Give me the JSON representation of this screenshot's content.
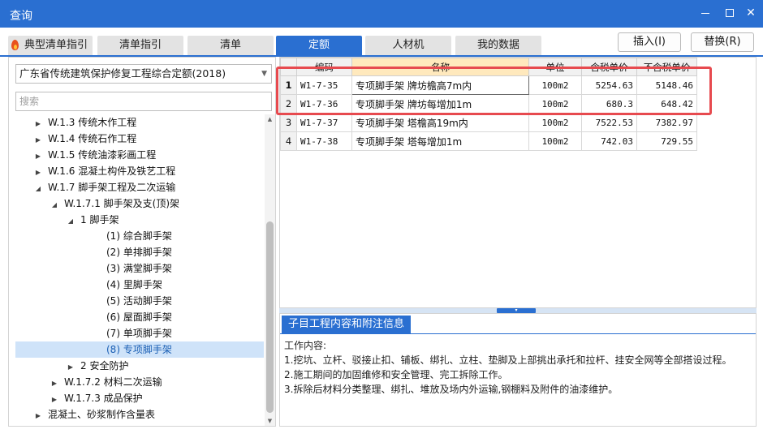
{
  "window": {
    "title": "查询"
  },
  "tabs": [
    {
      "label": "典型清单指引"
    },
    {
      "label": "清单指引"
    },
    {
      "label": "清单"
    },
    {
      "label": "定额"
    },
    {
      "label": "人材机"
    },
    {
      "label": "我的数据"
    }
  ],
  "actions": {
    "insert": "插入(I)",
    "replace": "替换(R)"
  },
  "left": {
    "library": "广东省传统建筑保护修复工程综合定额(2018)",
    "search_placeholder": "搜索",
    "tree": [
      {
        "label": "W.1.3 传统木作工程",
        "level": 1,
        "expander": "collapsed"
      },
      {
        "label": "W.1.4 传统石作工程",
        "level": 1,
        "expander": "collapsed"
      },
      {
        "label": "W.1.5 传统油漆彩画工程",
        "level": 1,
        "expander": "collapsed"
      },
      {
        "label": "W.1.6 混凝土构件及铁艺工程",
        "level": 1,
        "expander": "collapsed"
      },
      {
        "label": "W.1.7 脚手架工程及二次运输",
        "level": 1,
        "expander": "expanded"
      },
      {
        "label": "W.1.7.1 脚手架及支(顶)架",
        "level": 2,
        "expander": "expanded"
      },
      {
        "label": "1 脚手架",
        "level": 3,
        "expander": "expanded"
      },
      {
        "label": "(1) 综合脚手架",
        "level": 4,
        "expander": "none"
      },
      {
        "label": "(2) 单排脚手架",
        "level": 4,
        "expander": "none"
      },
      {
        "label": "(3) 满堂脚手架",
        "level": 4,
        "expander": "none"
      },
      {
        "label": "(4) 里脚手架",
        "level": 4,
        "expander": "none"
      },
      {
        "label": "(5) 活动脚手架",
        "level": 4,
        "expander": "none"
      },
      {
        "label": "(6) 屋面脚手架",
        "level": 4,
        "expander": "none"
      },
      {
        "label": "(7) 单项脚手架",
        "level": 4,
        "expander": "none"
      },
      {
        "label": "(8) 专项脚手架",
        "level": 4,
        "expander": "none",
        "selected": true
      },
      {
        "label": "2 安全防护",
        "level": 3,
        "expander": "collapsed"
      },
      {
        "label": "W.1.7.2 材料二次运输",
        "level": 2,
        "expander": "collapsed"
      },
      {
        "label": "W.1.7.3 成品保护",
        "level": 2,
        "expander": "collapsed"
      },
      {
        "label": "混凝土、砂浆制作含量表",
        "level": 1,
        "expander": "collapsed"
      }
    ]
  },
  "grid": {
    "columns": [
      "",
      "编码",
      "名称",
      "单位",
      "含税单价",
      "不含税单价"
    ],
    "rows": [
      {
        "idx": "1",
        "code": "W1-7-35",
        "name": "专项脚手架 牌坊檐高7m内",
        "unit": "100m2",
        "price_tax": "5254.63",
        "price_notax": "5148.46"
      },
      {
        "idx": "2",
        "code": "W1-7-36",
        "name": "专项脚手架 牌坊每增加1m",
        "unit": "100m2",
        "price_tax": "680.3",
        "price_notax": "648.42"
      },
      {
        "idx": "3",
        "code": "W1-7-37",
        "name": "专项脚手架 塔檐高19m内",
        "unit": "100m2",
        "price_tax": "7522.53",
        "price_notax": "7382.97"
      },
      {
        "idx": "4",
        "code": "W1-7-38",
        "name": "专项脚手架 塔每增加1m",
        "unit": "100m2",
        "price_tax": "742.03",
        "price_notax": "729.55"
      }
    ]
  },
  "detail": {
    "tab": "子目工程内容和附注信息",
    "lines": [
      "工作内容:",
      "1.挖坑、立杆、驳接止扣、铺板、绑扎、立柱、垫脚及上部挑出承托和拉杆、挂安全网等全部搭设过程。",
      "2.施工期间的加固维修和安全管理、完工拆除工作。",
      "3.拆除后材料分类整理、绑扎、堆放及场内外运输,钢棚料及附件的油漆维护。"
    ]
  },
  "colors": {
    "accent": "#2a6fd1",
    "highlight": "#e74a4f",
    "name_header": "#ffe9bd",
    "selected_row": "#cfe3f9"
  },
  "icons": {
    "tab_badge": "flame-icon"
  }
}
